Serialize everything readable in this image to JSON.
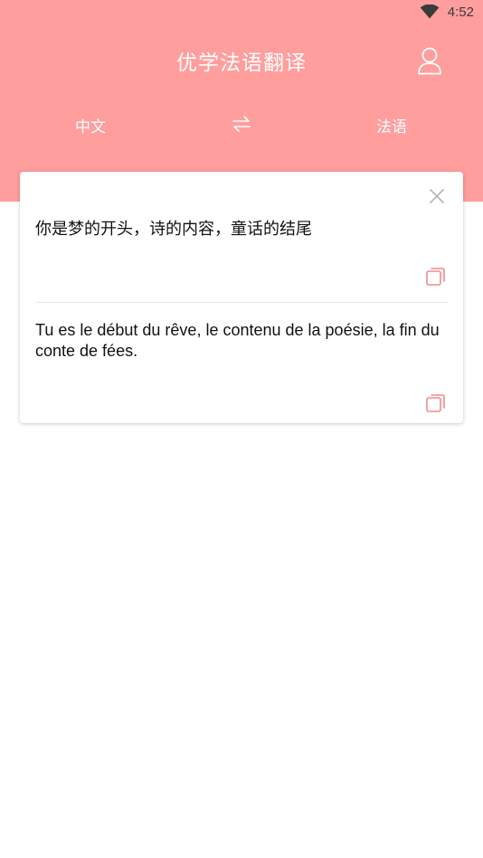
{
  "status_bar": {
    "time": "4:52",
    "wifi_icon": "wifi-icon"
  },
  "header": {
    "title": "优学法语翻译",
    "user_icon": "user-icon",
    "background_color": "#ff9e9d"
  },
  "language_bar": {
    "source_lang": "中文",
    "swap_icon": "swap-arrows-icon",
    "target_lang": "法语"
  },
  "translation_card": {
    "close_icon": "close-icon",
    "source_text": "你是梦的开头，诗的内容，童话的结尾",
    "copy_source_icon": "copy-icon",
    "result_text": "Tu es le début du rêve, le contenu de la poésie, la fin du conte de fées.",
    "copy_result_icon": "copy-icon",
    "accent_color": "#f28b8b"
  }
}
